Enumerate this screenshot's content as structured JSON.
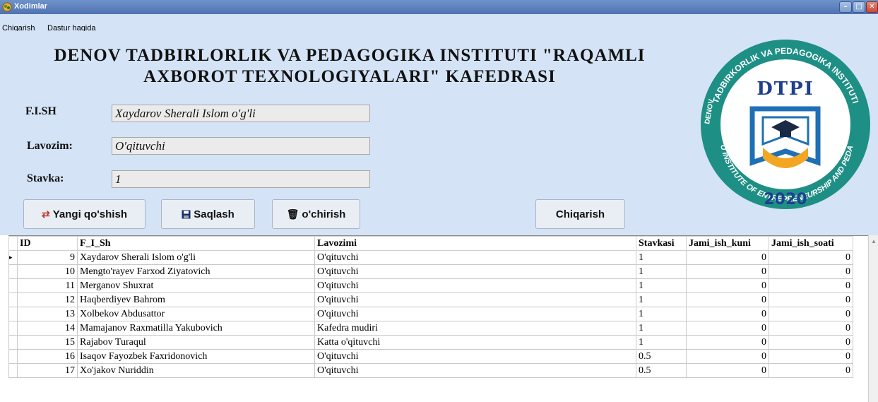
{
  "window": {
    "title": "Xodimlar",
    "controls": {
      "minimize": "–",
      "maximize": "□",
      "close": "✕"
    }
  },
  "menu": {
    "items": [
      "Chiqarish",
      "Dastur haqida"
    ]
  },
  "header": {
    "line1": "DENOV TADBIRLORLIK VA PEDAGOGIKA INSTITUTI \"RAQAMLI",
    "line2": "AXBOROT TEXNOLOGIYALARI\" KAFEDRASI"
  },
  "form": {
    "fish_label": "F.I.SH",
    "fish_value": "Xaydarov Sherali Islom o'g'li",
    "lavozim_label": "Lavozim:",
    "lavozim_value": "O'qituvchi",
    "stavka_label": "Stavka:",
    "stavka_value": "1"
  },
  "buttons": {
    "add": "Yangi qo'shish",
    "save": "Saqlash",
    "delete": "o'chirish",
    "exit": "Chiqarish"
  },
  "logo": {
    "text_top": "TADBIRKORLIK VA PEDAGOGIKA INSTITUTI",
    "text_left": "DENOV",
    "text_bottom": "DENOU INSTITUTE OF ENTREPRENEURSHIP AND PEDAGOGY",
    "acronym": "DTPI",
    "year": "2020",
    "colors": {
      "ring": "#1e8f85",
      "inner": "#ffffff",
      "book_blue": "#1f6fb5",
      "book_orange": "#f2a623"
    }
  },
  "table": {
    "columns": [
      "ID",
      "F_I_Sh",
      "Lavozimi",
      "Stavkasi",
      "Jami_ish_kuni",
      "Jami_ish_soati"
    ],
    "rows": [
      [
        "9",
        "Xaydarov Sherali Islom o'g'li",
        "O'qituvchi",
        "1",
        "0",
        "0"
      ],
      [
        "10",
        "Mengto'rayev Farxod Ziyatovich",
        "O'qituvchi",
        "1",
        "0",
        "0"
      ],
      [
        "11",
        "Merganov Shuxrat",
        "O'qituvchi",
        "1",
        "0",
        "0"
      ],
      [
        "12",
        "Haqberdiyev Bahrom",
        "O'qituvchi",
        "1",
        "0",
        "0"
      ],
      [
        "13",
        "Xolbekov Abdusattor",
        "O'qituvchi",
        "1",
        "0",
        "0"
      ],
      [
        "14",
        "Mamajanov Raxmatilla Yakubovich",
        "Kafedra mudiri",
        "1",
        "0",
        "0"
      ],
      [
        "15",
        "Rajabov Turaqul",
        "Katta o'qituvchi",
        "1",
        "0",
        "0"
      ],
      [
        "16",
        "Isaqov Fayozbek Faxridonovich",
        "O'qituvchi",
        "0.5",
        "0",
        "0"
      ],
      [
        "17",
        "Xo'jakov Nuriddin",
        "O'qituvchi",
        "0.5",
        "0",
        "0"
      ]
    ],
    "current_row_marker": "▸"
  }
}
